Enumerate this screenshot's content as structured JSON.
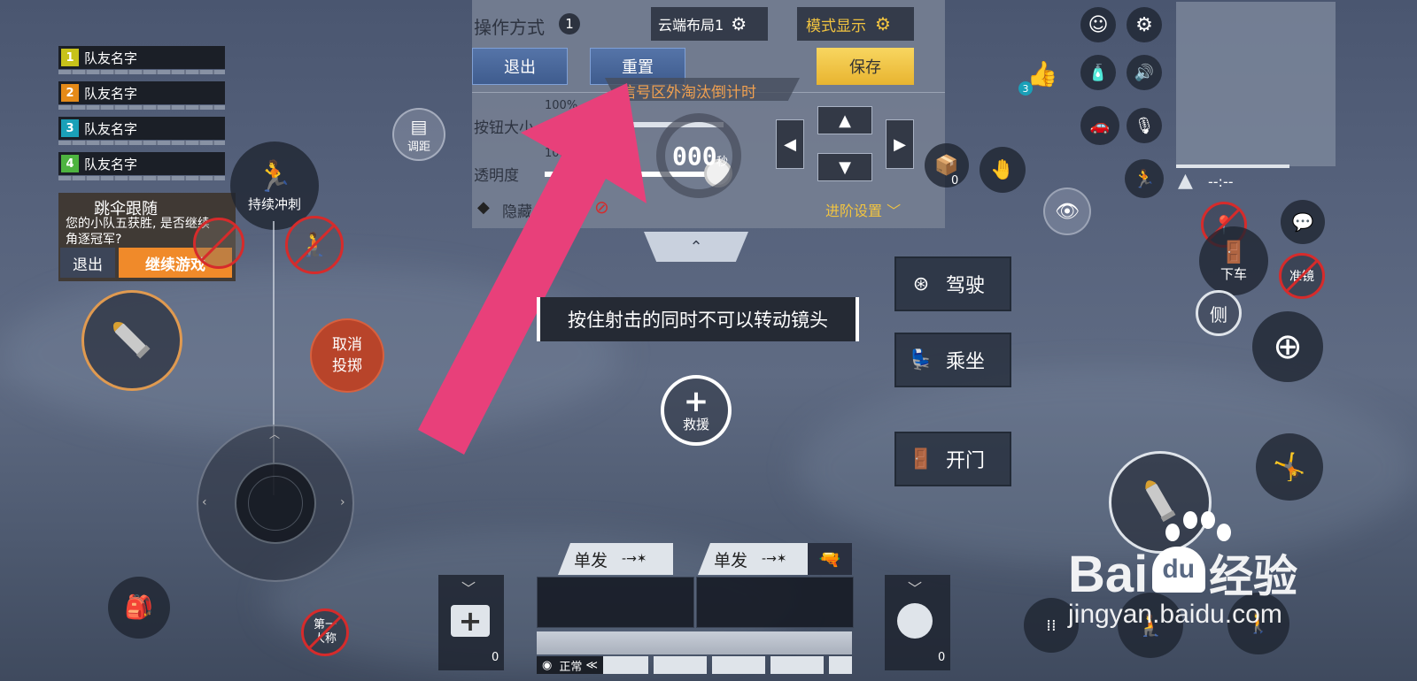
{
  "teammates": [
    {
      "num": "1",
      "name": "队友名字",
      "color": "#c7c21a"
    },
    {
      "num": "2",
      "name": "队友名字",
      "color": "#e58a18"
    },
    {
      "num": "3",
      "name": "队友名字",
      "color": "#1aa0b8"
    },
    {
      "num": "4",
      "name": "队友名字",
      "color": "#4eb440"
    }
  ],
  "popup": {
    "title": "跳伞跟随",
    "message": "您的小队五获胜, 是否继续角逐冠军?",
    "exit": "退出",
    "continue": "继续游戏"
  },
  "panel": {
    "title": "操作方式",
    "badge": "1",
    "cloud_layout": "云端布局1",
    "mode_display": "模式显示",
    "exit": "退出",
    "reset": "重置",
    "save": "保存",
    "banner": "信号区外淘汰倒计时",
    "size_label": "按钮大小",
    "size_value": "100%",
    "opacity_label": "透明度",
    "opacity_value": "100%",
    "hide_label": "隐藏",
    "advanced": "进阶设置",
    "timer": "000",
    "timer_unit": "秒"
  },
  "controls": {
    "sprint": "持续冲刺",
    "distance": "调距",
    "cancel_throw_1": "取消",
    "cancel_throw_2": "投掷",
    "rescue": "救援",
    "first_person_1": "第一",
    "first_person_2": "人称",
    "tooltip": "按住射击的同时不可以转动镜头",
    "drive": "驾驶",
    "ride": "乘坐",
    "open_door": "开门",
    "get_off": "下车",
    "scope": "准镜",
    "side": "侧",
    "like_count": "3",
    "box_count": "0",
    "medkit_count": "0",
    "grenade_count": "0"
  },
  "weapons": {
    "slot1_mode": "单发",
    "slot2_mode": "单发",
    "status": "正常"
  },
  "minimap": {
    "time": "--:--"
  },
  "watermark": {
    "brand": "Bai",
    "brand2": "经验",
    "url": "jingyan.baidu.com"
  },
  "colors": {
    "arrow": "#e8407a",
    "save": "#f2c440",
    "orange": "#f08a2a"
  }
}
